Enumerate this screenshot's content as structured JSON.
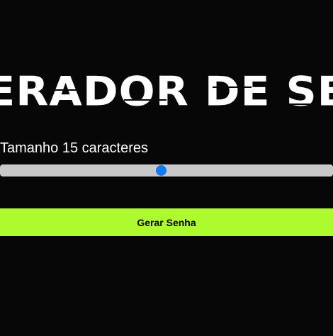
{
  "header": {
    "title": "GERADOR DE SENHA"
  },
  "controls": {
    "length_label": "Tamanho 15 caracteres",
    "length_slider": {
      "min": 1,
      "max": 30,
      "value": 15
    },
    "generate_button_label": "Gerar Senha"
  },
  "colors": {
    "background": "#070707",
    "accent_button": "#adfa2f",
    "slider_track": "#c9c9c9",
    "slider_thumb": "#1479f5",
    "text": "#ffffff"
  }
}
